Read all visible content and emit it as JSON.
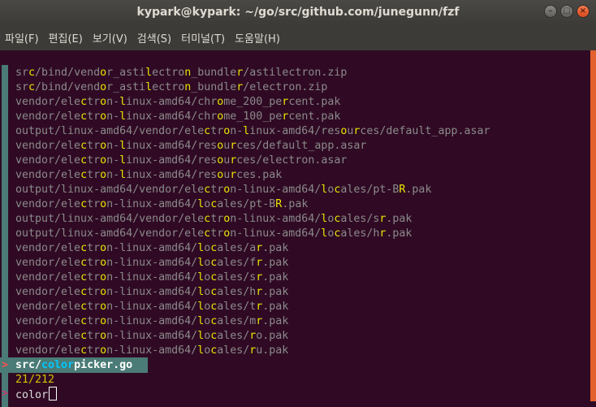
{
  "window": {
    "title": "kypark@kypark: ~/go/src/github.com/junegunn/fzf"
  },
  "menu": [
    "파일(F)",
    "편집(E)",
    "보기(V)",
    "검색(S)",
    "터미널(T)",
    "도움말(H)"
  ],
  "results": [
    {
      "segs": [
        {
          "t": "sr"
        },
        {
          "t": "c",
          "h": true
        },
        {
          "t": "/bind/vend"
        },
        {
          "t": "o",
          "h": true
        },
        {
          "t": "r_asti"
        },
        {
          "t": "l",
          "h": true
        },
        {
          "t": "ectro"
        },
        {
          "t": "n",
          "h": true
        },
        {
          "t": "_bundle"
        },
        {
          "t": "r",
          "h": true
        },
        {
          "t": "/astilectron.zip"
        }
      ]
    },
    {
      "segs": [
        {
          "t": "sr"
        },
        {
          "t": "c",
          "h": true
        },
        {
          "t": "/bind/vend"
        },
        {
          "t": "o",
          "h": true
        },
        {
          "t": "r_asti"
        },
        {
          "t": "l",
          "h": true
        },
        {
          "t": "ectro"
        },
        {
          "t": "n",
          "h": true
        },
        {
          "t": "_bundle"
        },
        {
          "t": "r",
          "h": true
        },
        {
          "t": "/electron.zip"
        }
      ]
    },
    {
      "segs": [
        {
          "t": "vendor/ele"
        },
        {
          "t": "c",
          "h": true
        },
        {
          "t": "tr"
        },
        {
          "t": "o",
          "h": true
        },
        {
          "t": "n-"
        },
        {
          "t": "l",
          "h": true
        },
        {
          "t": "inux-amd64/chr"
        },
        {
          "t": "o",
          "h": true
        },
        {
          "t": "me_200_pe"
        },
        {
          "t": "r",
          "h": true
        },
        {
          "t": "cent.pak"
        }
      ]
    },
    {
      "segs": [
        {
          "t": "vendor/ele"
        },
        {
          "t": "c",
          "h": true
        },
        {
          "t": "tr"
        },
        {
          "t": "o",
          "h": true
        },
        {
          "t": "n-"
        },
        {
          "t": "l",
          "h": true
        },
        {
          "t": "inux-amd64/chr"
        },
        {
          "t": "o",
          "h": true
        },
        {
          "t": "me_100_pe"
        },
        {
          "t": "r",
          "h": true
        },
        {
          "t": "cent.pak"
        }
      ]
    },
    {
      "segs": [
        {
          "t": "output/linux-amd64/vendor/ele"
        },
        {
          "t": "c",
          "h": true
        },
        {
          "t": "tr"
        },
        {
          "t": "o",
          "h": true
        },
        {
          "t": "n-"
        },
        {
          "t": "l",
          "h": true
        },
        {
          "t": "inux-amd64/res"
        },
        {
          "t": "o",
          "h": true
        },
        {
          "t": "u"
        },
        {
          "t": "r",
          "h": true
        },
        {
          "t": "ces/default_app.asar"
        }
      ]
    },
    {
      "segs": [
        {
          "t": "vendor/ele"
        },
        {
          "t": "c",
          "h": true
        },
        {
          "t": "tr"
        },
        {
          "t": "o",
          "h": true
        },
        {
          "t": "n-"
        },
        {
          "t": "l",
          "h": true
        },
        {
          "t": "inux-amd64/res"
        },
        {
          "t": "o",
          "h": true
        },
        {
          "t": "u"
        },
        {
          "t": "r",
          "h": true
        },
        {
          "t": "ces/default_app.asar"
        }
      ]
    },
    {
      "segs": [
        {
          "t": "vendor/ele"
        },
        {
          "t": "c",
          "h": true
        },
        {
          "t": "tr"
        },
        {
          "t": "o",
          "h": true
        },
        {
          "t": "n-"
        },
        {
          "t": "l",
          "h": true
        },
        {
          "t": "inux-amd64/res"
        },
        {
          "t": "o",
          "h": true
        },
        {
          "t": "u"
        },
        {
          "t": "r",
          "h": true
        },
        {
          "t": "ces/electron.asar"
        }
      ]
    },
    {
      "segs": [
        {
          "t": "vendor/ele"
        },
        {
          "t": "c",
          "h": true
        },
        {
          "t": "tr"
        },
        {
          "t": "o",
          "h": true
        },
        {
          "t": "n-"
        },
        {
          "t": "l",
          "h": true
        },
        {
          "t": "inux-amd64/res"
        },
        {
          "t": "o",
          "h": true
        },
        {
          "t": "u"
        },
        {
          "t": "r",
          "h": true
        },
        {
          "t": "ces.pak"
        }
      ]
    },
    {
      "segs": [
        {
          "t": "output/linux-amd64/vendor/ele"
        },
        {
          "t": "c",
          "h": true
        },
        {
          "t": "tr"
        },
        {
          "t": "o",
          "h": true
        },
        {
          "t": "n-linux-amd64/"
        },
        {
          "t": "l",
          "h": true
        },
        {
          "t": "o"
        },
        {
          "t": "c",
          "h": true
        },
        {
          "t": "ales/pt-B"
        },
        {
          "t": "R",
          "h": true
        },
        {
          "t": ".pak"
        }
      ]
    },
    {
      "segs": [
        {
          "t": "vendor/ele"
        },
        {
          "t": "c",
          "h": true
        },
        {
          "t": "tr"
        },
        {
          "t": "o",
          "h": true
        },
        {
          "t": "n-linux-amd64/"
        },
        {
          "t": "l",
          "h": true
        },
        {
          "t": "o"
        },
        {
          "t": "c",
          "h": true
        },
        {
          "t": "ales/pt-B"
        },
        {
          "t": "R",
          "h": true
        },
        {
          "t": ".pak"
        }
      ]
    },
    {
      "segs": [
        {
          "t": "output/linux-amd64/vendor/ele"
        },
        {
          "t": "c",
          "h": true
        },
        {
          "t": "tr"
        },
        {
          "t": "o",
          "h": true
        },
        {
          "t": "n-linux-amd64/"
        },
        {
          "t": "l",
          "h": true
        },
        {
          "t": "o"
        },
        {
          "t": "c",
          "h": true
        },
        {
          "t": "ales/s"
        },
        {
          "t": "r",
          "h": true
        },
        {
          "t": ".pak"
        }
      ]
    },
    {
      "segs": [
        {
          "t": "output/linux-amd64/vendor/ele"
        },
        {
          "t": "c",
          "h": true
        },
        {
          "t": "tr"
        },
        {
          "t": "o",
          "h": true
        },
        {
          "t": "n-linux-amd64/"
        },
        {
          "t": "l",
          "h": true
        },
        {
          "t": "o"
        },
        {
          "t": "c",
          "h": true
        },
        {
          "t": "ales/h"
        },
        {
          "t": "r",
          "h": true
        },
        {
          "t": ".pak"
        }
      ]
    },
    {
      "segs": [
        {
          "t": "vendor/ele"
        },
        {
          "t": "c",
          "h": true
        },
        {
          "t": "tr"
        },
        {
          "t": "o",
          "h": true
        },
        {
          "t": "n-linux-amd64/"
        },
        {
          "t": "l",
          "h": true
        },
        {
          "t": "o"
        },
        {
          "t": "c",
          "h": true
        },
        {
          "t": "ales/a"
        },
        {
          "t": "r",
          "h": true
        },
        {
          "t": ".pak"
        }
      ]
    },
    {
      "segs": [
        {
          "t": "vendor/ele"
        },
        {
          "t": "c",
          "h": true
        },
        {
          "t": "tr"
        },
        {
          "t": "o",
          "h": true
        },
        {
          "t": "n-linux-amd64/"
        },
        {
          "t": "l",
          "h": true
        },
        {
          "t": "o"
        },
        {
          "t": "c",
          "h": true
        },
        {
          "t": "ales/f"
        },
        {
          "t": "r",
          "h": true
        },
        {
          "t": ".pak"
        }
      ]
    },
    {
      "segs": [
        {
          "t": "vendor/ele"
        },
        {
          "t": "c",
          "h": true
        },
        {
          "t": "tr"
        },
        {
          "t": "o",
          "h": true
        },
        {
          "t": "n-linux-amd64/"
        },
        {
          "t": "l",
          "h": true
        },
        {
          "t": "o"
        },
        {
          "t": "c",
          "h": true
        },
        {
          "t": "ales/s"
        },
        {
          "t": "r",
          "h": true
        },
        {
          "t": ".pak"
        }
      ]
    },
    {
      "segs": [
        {
          "t": "vendor/ele"
        },
        {
          "t": "c",
          "h": true
        },
        {
          "t": "tr"
        },
        {
          "t": "o",
          "h": true
        },
        {
          "t": "n-linux-amd64/"
        },
        {
          "t": "l",
          "h": true
        },
        {
          "t": "o"
        },
        {
          "t": "c",
          "h": true
        },
        {
          "t": "ales/h"
        },
        {
          "t": "r",
          "h": true
        },
        {
          "t": ".pak"
        }
      ]
    },
    {
      "segs": [
        {
          "t": "vendor/ele"
        },
        {
          "t": "c",
          "h": true
        },
        {
          "t": "tr"
        },
        {
          "t": "o",
          "h": true
        },
        {
          "t": "n-linux-amd64/"
        },
        {
          "t": "l",
          "h": true
        },
        {
          "t": "o"
        },
        {
          "t": "c",
          "h": true
        },
        {
          "t": "ales/t"
        },
        {
          "t": "r",
          "h": true
        },
        {
          "t": ".pak"
        }
      ]
    },
    {
      "segs": [
        {
          "t": "vendor/ele"
        },
        {
          "t": "c",
          "h": true
        },
        {
          "t": "tr"
        },
        {
          "t": "o",
          "h": true
        },
        {
          "t": "n-linux-amd64/"
        },
        {
          "t": "l",
          "h": true
        },
        {
          "t": "o"
        },
        {
          "t": "c",
          "h": true
        },
        {
          "t": "ales/m"
        },
        {
          "t": "r",
          "h": true
        },
        {
          "t": ".pak"
        }
      ]
    },
    {
      "segs": [
        {
          "t": "vendor/ele"
        },
        {
          "t": "c",
          "h": true
        },
        {
          "t": "tr"
        },
        {
          "t": "o",
          "h": true
        },
        {
          "t": "n-linux-amd64/"
        },
        {
          "t": "l",
          "h": true
        },
        {
          "t": "o"
        },
        {
          "t": "c",
          "h": true
        },
        {
          "t": "ales/"
        },
        {
          "t": "r",
          "h": true
        },
        {
          "t": "o.pak"
        }
      ]
    },
    {
      "segs": [
        {
          "t": "vendor/ele"
        },
        {
          "t": "c",
          "h": true
        },
        {
          "t": "tr"
        },
        {
          "t": "o",
          "h": true
        },
        {
          "t": "n-linux-amd64/"
        },
        {
          "t": "l",
          "h": true
        },
        {
          "t": "o"
        },
        {
          "t": "c",
          "h": true
        },
        {
          "t": "ales/"
        },
        {
          "t": "r",
          "h": true
        },
        {
          "t": "u.pak"
        }
      ]
    }
  ],
  "selected": {
    "pointer": ">",
    "prefix": "src/",
    "match": "color",
    "suffix": "picker.go"
  },
  "status": {
    "count": "21/212"
  },
  "prompt": {
    "symbol": ">",
    "query": "color"
  },
  "colors": {
    "background": "#300a24",
    "match": "#e7e600",
    "selected_match": "#00c8ff",
    "gutter": "#4a7b76",
    "scrollbar": "#e3602f",
    "prompt": "#e02e6d"
  }
}
